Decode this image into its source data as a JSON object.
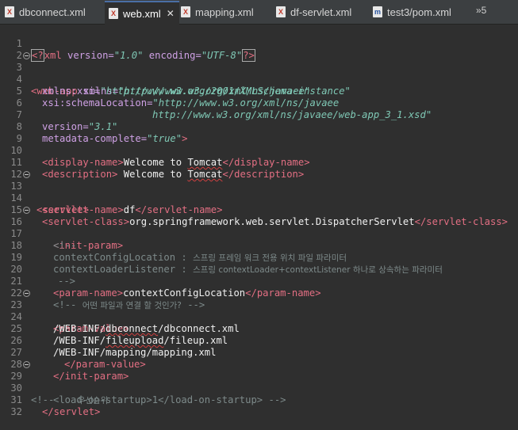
{
  "tabs": [
    {
      "label": "dbconnect.xml",
      "icon": "xml-file-icon",
      "active": false
    },
    {
      "label": "web.xml",
      "icon": "xml-file-icon",
      "active": true
    },
    {
      "label": "mapping.xml",
      "icon": "xml-file-icon",
      "active": false
    },
    {
      "label": "df-servlet.xml",
      "icon": "xml-file-icon",
      "active": false
    },
    {
      "label": "test3/pom.xml",
      "icon": "maven-pom-icon",
      "active": false
    }
  ],
  "overflow_label": "»5",
  "close_glyph": "✕",
  "line_numbers": [
    "1",
    "2",
    "3",
    "4",
    "5",
    "6",
    "7",
    "8",
    "9",
    "10",
    "11",
    "12",
    "13",
    "14",
    "15",
    "16",
    "17",
    "18",
    "19",
    "20",
    "21",
    "22",
    "23",
    "24",
    "25",
    "26",
    "27",
    "28",
    "29",
    "30",
    "31",
    "32"
  ],
  "code": {
    "l1": {
      "open": "<?",
      "name": "xml",
      "a1": " version=",
      "v1": "\"1.0\"",
      "a2": " encoding=",
      "v2": "\"UTF-8\"",
      "close": "?>"
    },
    "l3": {
      "tag": "<web-app",
      "attr": " xmlns=",
      "val": "\"http://www.w3.org/xml/ns/javaee\""
    },
    "l4": {
      "attr": "xmlns:xsi=",
      "val": "\"http://www.w3.org/2001/XMLSchema-instance\""
    },
    "l5": {
      "attr": "xsi:schemaLocation=",
      "val": "\"http://www.w3.org/xml/ns/javaee"
    },
    "l6": {
      "val": "http://www.w3.org/xml/ns/javaee/web-app_3_1.xsd\""
    },
    "l7": {
      "attr": "version=",
      "val": "\"3.1\""
    },
    "l8": {
      "attr": "metadata-complete=",
      "val": "\"true\"",
      "close": ">"
    },
    "l10": {
      "open": "<display-name>",
      "text1": "Welcome to ",
      "text2": "Tomcat",
      "close": "</display-name>"
    },
    "l11": {
      "open": "<description>",
      "text1": " Welcome to ",
      "text2": "Tomcat",
      "close": "</description>"
    },
    "l13": {
      "tag": "<servlet>"
    },
    "l14": {
      "open": "<servlet-name>",
      "text": "df",
      "close": "</servlet-name>"
    },
    "l15": {
      "open": "<servlet-class>",
      "text": "org.springframework.web.servlet.DispatcherServlet",
      "close": "</servlet-class>"
    },
    "l16": {
      "tag": "<init-param>"
    },
    "l17": {
      "cmt": "<!--"
    },
    "l18": {
      "cmt1": "contextConfigLocation : ",
      "cmt2": "스프링 프레임 워크 전용 위치 파일 파라미터"
    },
    "l19": {
      "cmt1": "contextLoaderListener : ",
      "cmt2": "스프링 contextLoader+contextListener 하나로 상속하는 파라미터"
    },
    "l20": {
      "cmt": "-->"
    },
    "l21": {
      "open": "<param-name>",
      "text": "contextConfigLocation",
      "close": "</param-name>"
    },
    "l22": {
      "cmt1": "<!-- ",
      "cmt2": "어떤 파일과 연결 할 것인가?",
      "cmt3": " -->"
    },
    "l23": {
      "tag": "<param-value>"
    },
    "l24": {
      "t1": "/WEB-INF/",
      "t2": "dbconnect",
      "t3": "/dbconnect.xml"
    },
    "l25": {
      "t1": "/WEB-INF/",
      "t2": "fileupload",
      "t3": "/fileup.xml"
    },
    "l26": {
      "t1": "/WEB-INF/mapping/mapping.xml"
    },
    "l27": {
      "tag": "</param-value>"
    },
    "l28": {
      "tag": "</init-param>"
    },
    "l29": {
      "cmt1": "<!--    ",
      "cmt2": "우선순위"
    },
    "l30": {
      "cmt": "<load-on-startup>1</load-on-startup> -->"
    },
    "l31": {
      "tag": "</servlet>"
    }
  }
}
